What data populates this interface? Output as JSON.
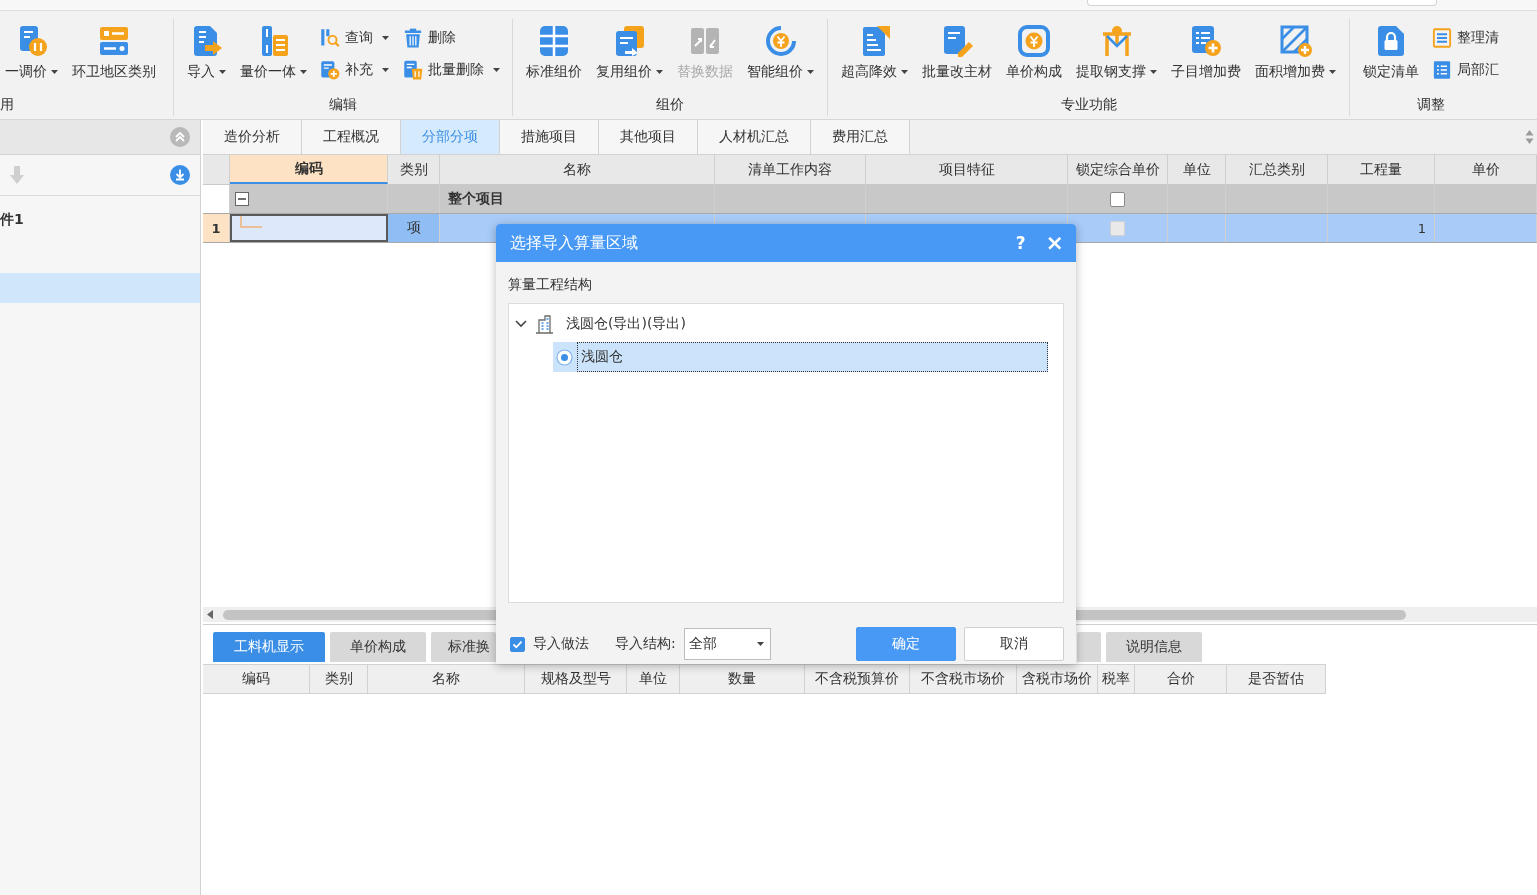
{
  "ribbon": {
    "groups": [
      {
        "label": "用",
        "buttons": [
          {
            "label": "一调价",
            "kind": "large",
            "dropdown": true,
            "disabled": false
          },
          {
            "label": "环卫地区类别",
            "kind": "large",
            "dropdown": false,
            "disabled": false
          }
        ]
      },
      {
        "label": "编辑",
        "buttons": [
          {
            "label": "导入",
            "kind": "large",
            "dropdown": true,
            "disabled": false
          },
          {
            "label": "量价一体",
            "kind": "large",
            "dropdown": true,
            "disabled": false
          },
          {
            "label": "查询",
            "kind": "small",
            "dropdown": true,
            "disabled": false
          },
          {
            "label": "补充",
            "kind": "small",
            "dropdown": true,
            "disabled": false
          },
          {
            "label": "删除",
            "kind": "small",
            "dropdown": false,
            "disabled": false
          },
          {
            "label": "批量删除",
            "kind": "small",
            "dropdown": true,
            "disabled": false
          }
        ]
      },
      {
        "label": "组价",
        "buttons": [
          {
            "label": "标准组价",
            "kind": "large",
            "dropdown": false,
            "disabled": false
          },
          {
            "label": "复用组价",
            "kind": "large",
            "dropdown": true,
            "disabled": false
          },
          {
            "label": "替换数据",
            "kind": "large",
            "dropdown": false,
            "disabled": true
          },
          {
            "label": "智能组价",
            "kind": "large",
            "dropdown": true,
            "disabled": false
          }
        ]
      },
      {
        "label": "专业功能",
        "buttons": [
          {
            "label": "超高降效",
            "kind": "large",
            "dropdown": true,
            "disabled": false
          },
          {
            "label": "批量改主材",
            "kind": "large",
            "dropdown": false,
            "disabled": false
          },
          {
            "label": "单价构成",
            "kind": "large",
            "dropdown": false,
            "disabled": false
          },
          {
            "label": "提取钢支撑",
            "kind": "large",
            "dropdown": true,
            "disabled": false
          },
          {
            "label": "子目增加费",
            "kind": "large",
            "dropdown": false,
            "disabled": false
          },
          {
            "label": "面积增加费",
            "kind": "large",
            "dropdown": true,
            "disabled": false
          }
        ]
      },
      {
        "label": "调整",
        "buttons": [
          {
            "label": "锁定清单",
            "kind": "large",
            "dropdown": false,
            "disabled": false
          },
          {
            "label": "整理清",
            "kind": "small",
            "dropdown": false,
            "disabled": false
          },
          {
            "label": "局部汇",
            "kind": "small",
            "dropdown": false,
            "disabled": false
          }
        ]
      }
    ]
  },
  "sidebar": {
    "move_down_disabled": true,
    "items": [
      {
        "label": "件1",
        "selected": false
      },
      {
        "selected": true
      }
    ]
  },
  "tabs": [
    {
      "label": "造价分析",
      "selected": false
    },
    {
      "label": "工程概况",
      "selected": false
    },
    {
      "label": "分部分项",
      "selected": true
    },
    {
      "label": "措施项目",
      "selected": false
    },
    {
      "label": "其他项目",
      "selected": false
    },
    {
      "label": "人材机汇总",
      "selected": false
    },
    {
      "label": "费用汇总",
      "selected": false
    }
  ],
  "table": {
    "columns": [
      {
        "label": "编码",
        "highlighted": true
      },
      {
        "label": "类别",
        "highlighted": false
      },
      {
        "label": "名称",
        "highlighted": false
      },
      {
        "label": "清单工作内容",
        "highlighted": false
      },
      {
        "label": "项目特征",
        "highlighted": false
      },
      {
        "label": "锁定综合单价",
        "highlighted": false
      },
      {
        "label": "单位",
        "highlighted": false
      },
      {
        "label": "汇总类别",
        "highlighted": false
      },
      {
        "label": "工程量",
        "highlighted": false
      },
      {
        "label": "单价",
        "highlighted": false
      }
    ],
    "rows": [
      {
        "kind": "group",
        "name": "整个项目",
        "expanded": true,
        "selected": false,
        "lock": {
          "checked": false,
          "disabled": false
        }
      },
      {
        "kind": "item",
        "number": "1",
        "type": "项",
        "quantity": "1",
        "selected": true,
        "lock": {
          "checked": false,
          "disabled": true
        }
      }
    ]
  },
  "detail_tabs": [
    {
      "label": "工料机显示",
      "selected": true
    },
    {
      "label": "单价构成",
      "selected": false
    },
    {
      "label": "标准换",
      "selected": false
    },
    {
      "label": "说明信息",
      "selected": false
    }
  ],
  "detail_table": {
    "columns": [
      "编码",
      "类别",
      "名称",
      "规格及型号",
      "单位",
      "数量",
      "不含税预算价",
      "不含税市场价",
      "含税市场价",
      "税率",
      "合价",
      "是否暂估"
    ]
  },
  "dialog": {
    "title": "选择导入算量区域",
    "help_button": "?",
    "close_button": "×",
    "tree_label": "算量工程结构",
    "tree": [
      {
        "label": "浅圆仓(导出)(导出)",
        "expanded": true,
        "selected": false,
        "children": [
          {
            "label": "浅圆仓",
            "selected": true
          }
        ]
      }
    ],
    "import_method": {
      "label": "导入做法",
      "checked": true
    },
    "structure": {
      "label": "导入结构:",
      "value": "全部"
    },
    "buttons": [
      {
        "label": "确定",
        "primary": true
      },
      {
        "label": "取消",
        "primary": false
      }
    ]
  }
}
